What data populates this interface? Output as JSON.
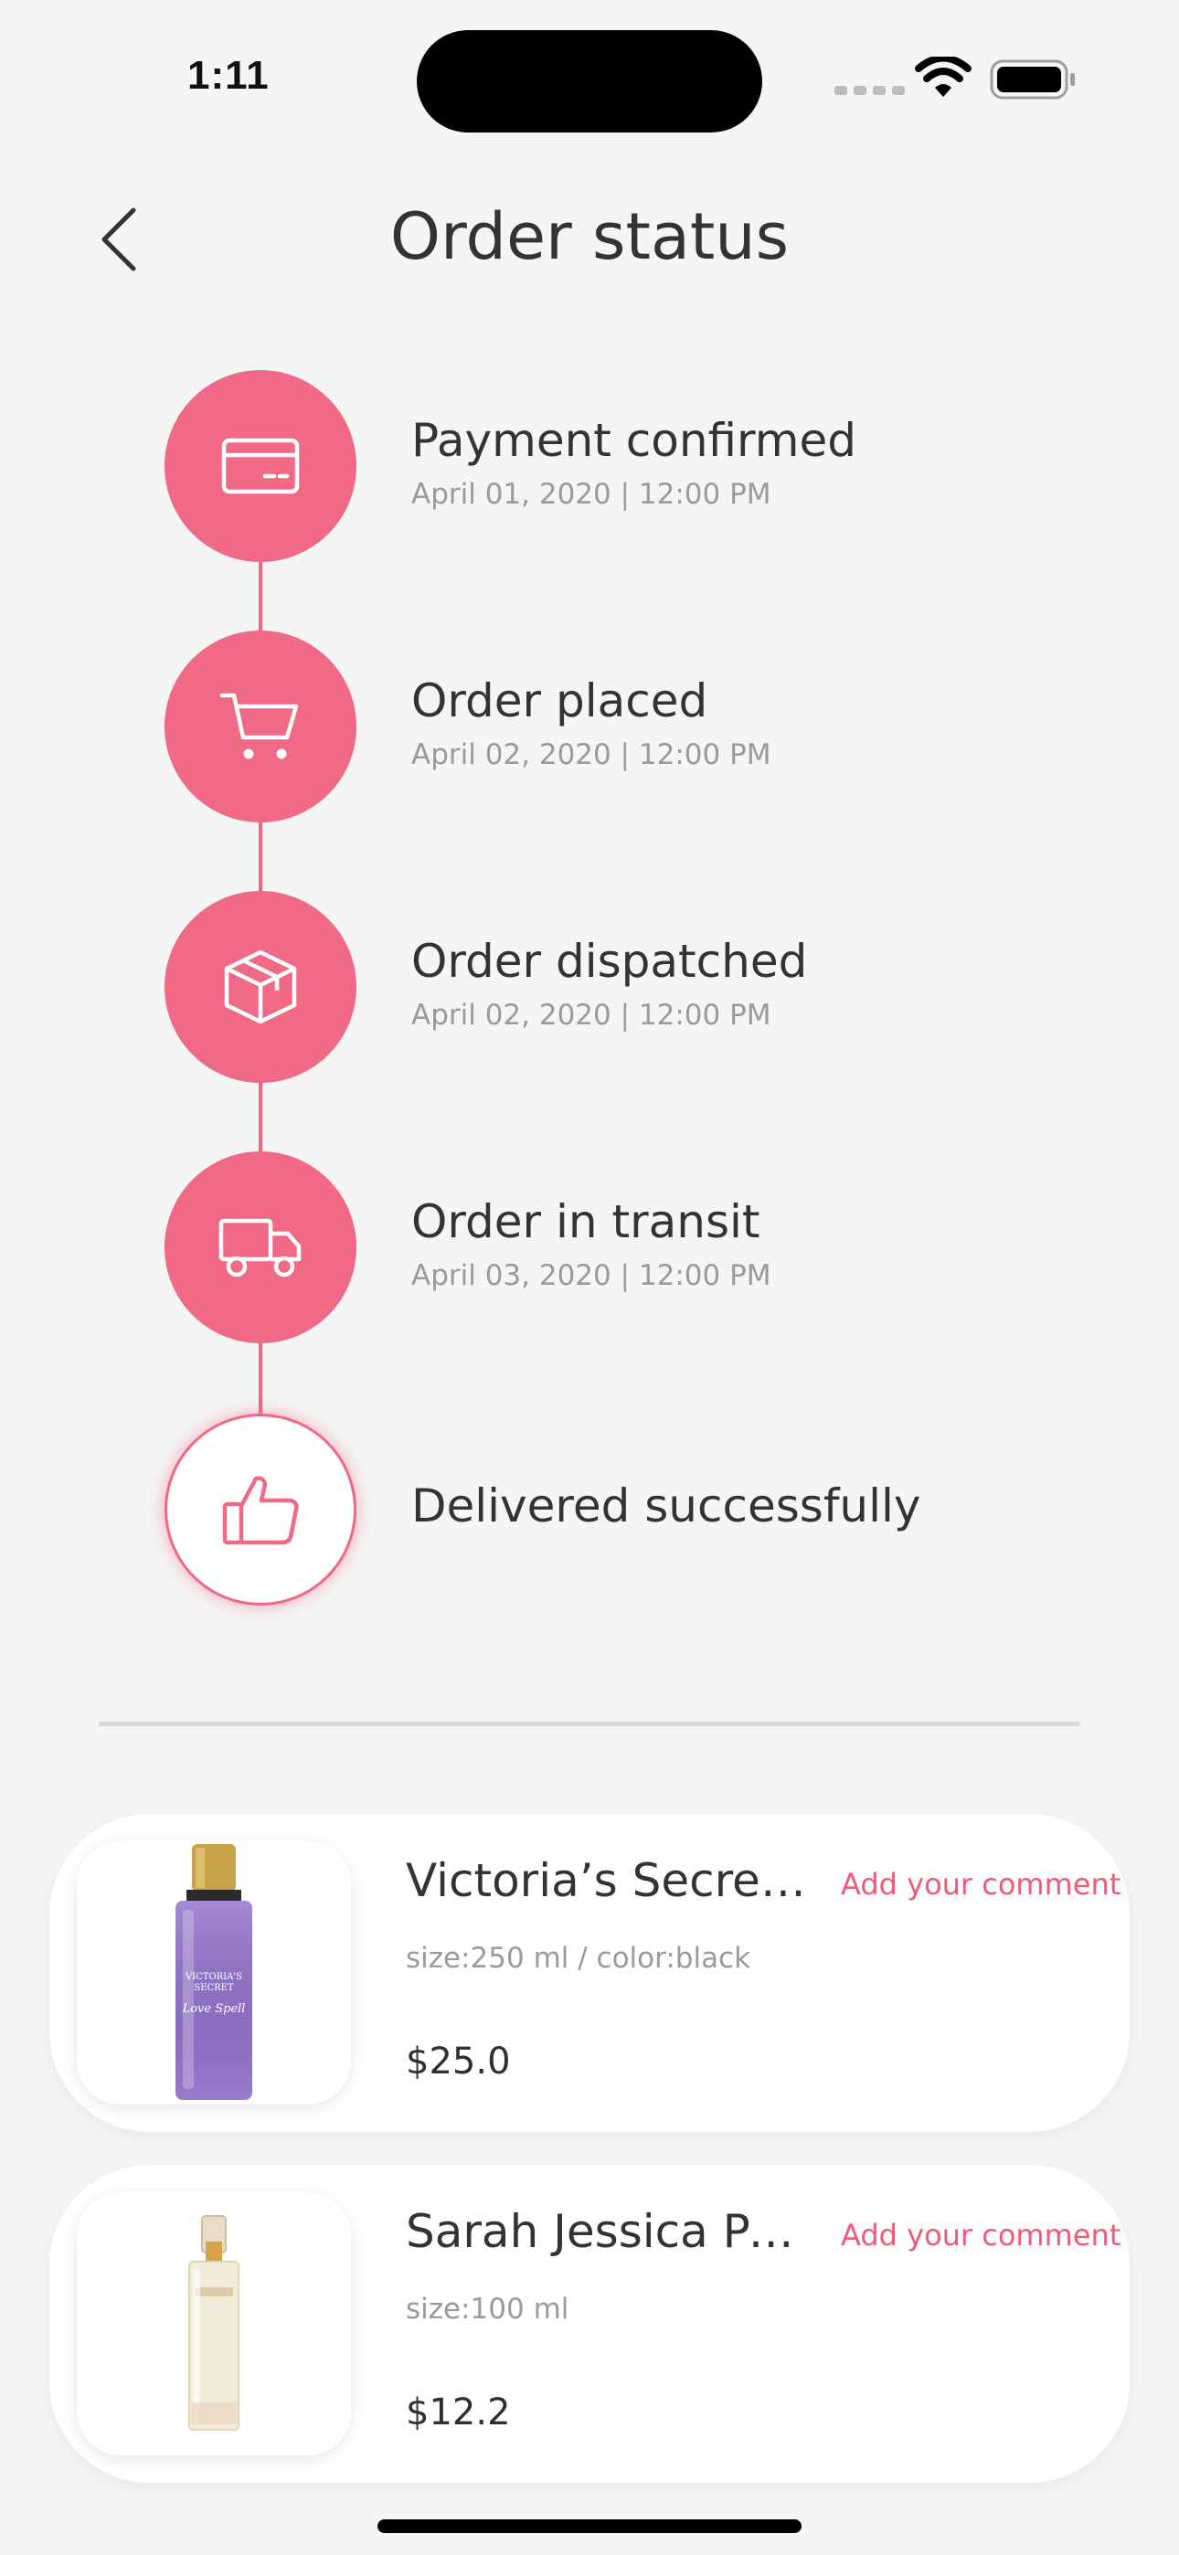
{
  "status_bar": {
    "time": "1:11"
  },
  "header": {
    "title": "Order status"
  },
  "timeline": [
    {
      "title": "Payment confirmed",
      "date": "April 01, 2020 | 12:00 PM",
      "icon": "credit-card-icon"
    },
    {
      "title": "Order placed",
      "date": "April 02, 2020 | 12:00 PM",
      "icon": "cart-icon"
    },
    {
      "title": "Order dispatched",
      "date": "April 02, 2020 | 12:00 PM",
      "icon": "box-icon"
    },
    {
      "title": "Order in transit",
      "date": "April 03, 2020 | 12:00 PM",
      "icon": "truck-icon"
    },
    {
      "title": "Delivered successfully",
      "date": "",
      "icon": "thumbs-up-icon"
    }
  ],
  "products": [
    {
      "name": "Victoria’s Secret Love Spell Fragrance Mist",
      "meta": "size:250 ml / color:black",
      "price": "$25.0",
      "comment_label": "Add your comment",
      "image": "purple-perfume-bottle"
    },
    {
      "name": "Sarah Jessica Parker Lovely Eau de Parfum",
      "meta": "size:100 ml",
      "price": "$12.2",
      "comment_label": "Add your comment",
      "image": "clear-perfume-bottle"
    }
  ],
  "colors": {
    "accent": "#f06985",
    "background": "#f5f5f5",
    "card": "#ffffff"
  }
}
